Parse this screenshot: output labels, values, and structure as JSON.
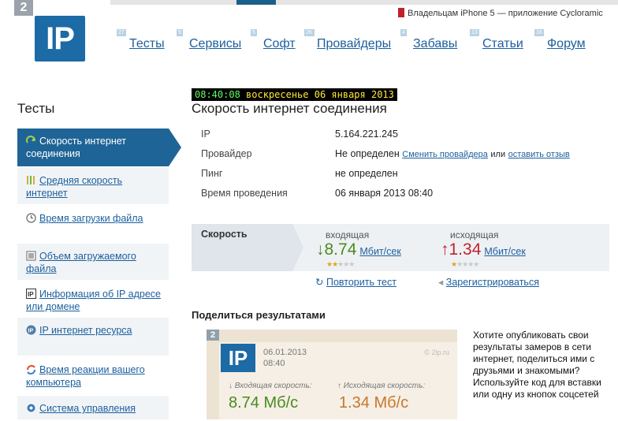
{
  "header": {
    "badge": "2",
    "logo": "IP",
    "promo": "Владельцам iPhone 5 — приложение Cycloramic"
  },
  "nav": [
    {
      "num": "27",
      "label": "Тесты"
    },
    {
      "num": "9",
      "label": "Сервисы"
    },
    {
      "num": "5",
      "label": "Софт"
    },
    {
      "num": "2K",
      "label": "Провайдеры"
    },
    {
      "num": "4",
      "label": "Забавы"
    },
    {
      "num": "13",
      "label": "Статьи"
    },
    {
      "num": "16",
      "label": "Форум"
    }
  ],
  "clock": {
    "time": "08:40:08",
    "date": "воскресенье 06 января 2013"
  },
  "sidebar": {
    "title": "Тесты",
    "items": [
      {
        "label": "Скорость интернет соединения",
        "icon": "speed-arrow-icon"
      },
      {
        "label": "Средняя скорость интернет",
        "icon": "bars-icon"
      },
      {
        "label": "Время загрузки файла",
        "icon": "clock-icon"
      },
      {
        "label": "Объем загружаемого файла",
        "icon": "file-icon"
      },
      {
        "label": "Информация об IP адресе или домене",
        "icon": "ip-icon"
      },
      {
        "label": "IP интернет ресурса",
        "icon": "globe-ip-icon"
      },
      {
        "label": "Время реакции вашего компьютера",
        "icon": "reaction-icon"
      },
      {
        "label": "Система управления",
        "icon": "gear-icon"
      }
    ]
  },
  "main": {
    "title": "Скорость интернет соединения",
    "rows": [
      {
        "label": "IP",
        "value": "5.164.221.245"
      },
      {
        "label": "Провайдер",
        "value": "Не определен",
        "link1": "Сменить провайдера",
        "sep": "или",
        "link2": "оставить отзыв"
      },
      {
        "label": "Пинг",
        "value": "не определен"
      },
      {
        "label": "Время проведения",
        "value": "06 января 2013 08:40"
      }
    ],
    "speed": {
      "label": "Скорость",
      "in_head": "входящая",
      "in_value": "8.74",
      "out_head": "исходящая",
      "out_value": "1.34",
      "unit": "Мбит/сек",
      "in_arrow": "↓",
      "out_arrow": "↑"
    },
    "repeat": "Повторить тест",
    "register": "Зарегистрироваться",
    "share_title": "Поделиться результатами",
    "card": {
      "badge": "2",
      "logo": "IP",
      "date": "06.01.2013",
      "time": "08:40",
      "site": "© 2ip.ru",
      "in_head": "↓ Входящая скорость:",
      "out_head": "↑ Исходящая скорость:",
      "in_value": "8.74 Мб/с",
      "out_value": "1.34 Мб/с"
    },
    "share_text": "Хотите опубликовать свои результаты замеров в сети интернет, поделиться ими с друзьями и знакомыми? Используйте код для вставки или одну из кнопок соцсетей"
  },
  "colors": {
    "brand": "#1c6aa6",
    "link": "#1c5f9e",
    "in_green": "#4a8a1e",
    "out_red": "#c0222d"
  }
}
